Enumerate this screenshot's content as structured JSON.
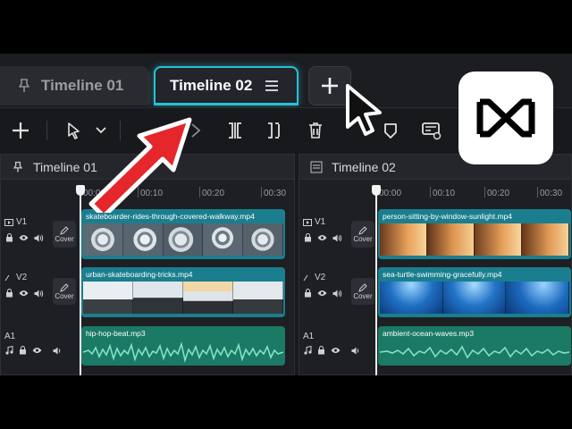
{
  "tabs": [
    {
      "label": "Timeline 01",
      "active": false
    },
    {
      "label": "Timeline 02",
      "active": true
    }
  ],
  "panels": [
    {
      "title": "Timeline 01",
      "ticks": [
        "00:00",
        "00:10",
        "00:20",
        "00:30"
      ],
      "tracks": [
        {
          "name": "V1",
          "type": "video",
          "clip": "skateboarder-rides-through-covered-walkway.mp4",
          "cover": "Cover"
        },
        {
          "name": "V2",
          "type": "video",
          "clip": "urban-skateboarding-tricks.mp4",
          "cover": "Cover"
        },
        {
          "name": "A1",
          "type": "audio",
          "clip": "hip-hop-beat.mp3"
        }
      ]
    },
    {
      "title": "Timeline 02",
      "ticks": [
        "00:00",
        "00:10",
        "00:20",
        "00:30"
      ],
      "tracks": [
        {
          "name": "V1",
          "type": "video",
          "clip": "person-sitting-by-window-sunlight.mp4",
          "cover": "Cover"
        },
        {
          "name": "V2",
          "type": "video",
          "clip": "sea-turtle-swimming-gracefully.mp4",
          "cover": "Cover"
        },
        {
          "name": "A1",
          "type": "audio",
          "clip": "ambient-ocean-waves.mp3"
        }
      ]
    }
  ],
  "colors": {
    "accent": "#27c0d6",
    "video_clip": "#1a7e8e",
    "audio_clip": "#1a7a66",
    "annotation_arrow": "#e5262b"
  },
  "icons": {
    "toolbar": [
      "plus-icon",
      "select-cursor-icon",
      "chevron-down-icon",
      "split-icon",
      "trim-left-icon",
      "trim-right-icon",
      "delete-icon",
      "marker-icon",
      "caption-icon"
    ],
    "track": [
      "lock-icon",
      "eye-icon",
      "volume-icon",
      "edit-icon"
    ],
    "brand": "capcut-logo-icon"
  }
}
